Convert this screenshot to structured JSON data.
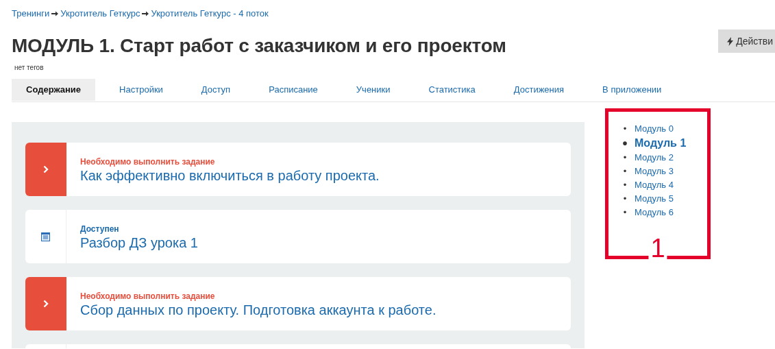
{
  "breadcrumbs": [
    "Тренинги",
    "Укротитель Геткурс",
    "Укротитель Геткурс - 4 поток"
  ],
  "title": "МОДУЛЬ 1. Старт работ с заказчиком и его проектом",
  "tags": "нет тегов",
  "actions_button": "Действи",
  "tabs": [
    {
      "label": "Содержание",
      "selected": true
    },
    {
      "label": "Настройки",
      "selected": false
    },
    {
      "label": "Доступ",
      "selected": false
    },
    {
      "label": "Расписание",
      "selected": false
    },
    {
      "label": "Ученики",
      "selected": false
    },
    {
      "label": "Статистика",
      "selected": false
    },
    {
      "label": "Достижения",
      "selected": false
    },
    {
      "label": "В приложении",
      "selected": false
    }
  ],
  "lessons": [
    {
      "kind": "task",
      "status": "Необходимо выполнить задание",
      "title": "Как эффективно включиться в работу проекта."
    },
    {
      "kind": "available",
      "status": "Доступен",
      "title": "Разбор ДЗ урока 1"
    },
    {
      "kind": "task",
      "status": "Необходимо выполнить задание",
      "title": "Сбор данных по проекту. Подготовка аккаунта к работе."
    },
    {
      "kind": "empty"
    }
  ],
  "modules": [
    {
      "bullet": "•",
      "label": "Модуль 0",
      "selected": false
    },
    {
      "bullet": "•",
      "label": "Модуль 1",
      "selected": true
    },
    {
      "bullet": "•",
      "label": "Модуль 2",
      "selected": false
    },
    {
      "bullet": "•",
      "label": "Модуль 3",
      "selected": false
    },
    {
      "bullet": "•",
      "label": "Модуль 4",
      "selected": false
    },
    {
      "bullet": "•",
      "label": "Модуль 5",
      "selected": false
    },
    {
      "bullet": "•",
      "label": "Модуль 6",
      "selected": false
    }
  ],
  "annotation": {
    "label": "1"
  }
}
